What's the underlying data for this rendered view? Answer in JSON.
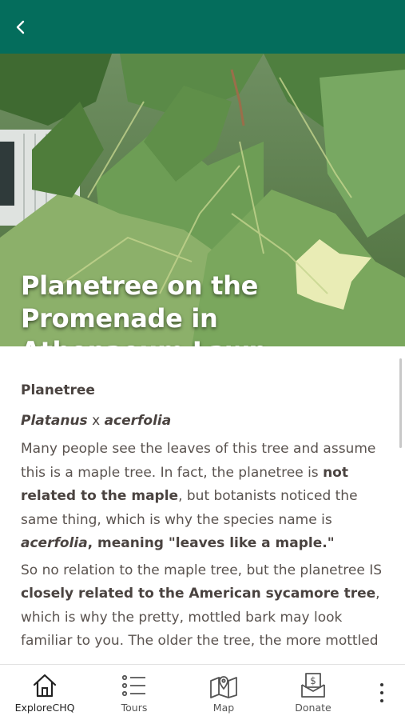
{
  "header": {
    "back_icon": "chevron-left-icon",
    "background_color": "#046d5c"
  },
  "hero": {
    "title": "Planetree on the Promenade in Athenaeum Lawn",
    "image_subject": "green planetree leaves"
  },
  "article": {
    "common_name": "Planetree",
    "latin_genus": "Platanus",
    "latin_connector": " x ",
    "latin_species": "acerfolia",
    "p1_a": "Many people see the leaves of this tree and assume this is a maple tree. In fact, the planetree is ",
    "p1_b": "not related to the maple",
    "p1_c": ", but botanists noticed the same thing, which is why the species name is ",
    "p1_d": "acerfolia",
    "p1_e": ", meaning \"leaves like a maple.\"",
    "p2_a": "So no relation to the maple tree, but the planetree IS ",
    "p2_b": "closely related to the American sycamore tree",
    "p2_c": ", which is why the pretty, mottled bark may look familiar to you. The older the tree, the more mottled"
  },
  "bottom_nav": {
    "items": [
      {
        "label": "ExploreCHQ",
        "icon": "home-icon",
        "active": true
      },
      {
        "label": "Tours",
        "icon": "list-icon",
        "active": false
      },
      {
        "label": "Map",
        "icon": "map-pin-icon",
        "active": false
      },
      {
        "label": "Donate",
        "icon": "donate-icon",
        "active": false
      }
    ],
    "more_icon": "more-vertical-icon"
  },
  "colors": {
    "accent": "#046d5c",
    "text": "#4a4340"
  }
}
